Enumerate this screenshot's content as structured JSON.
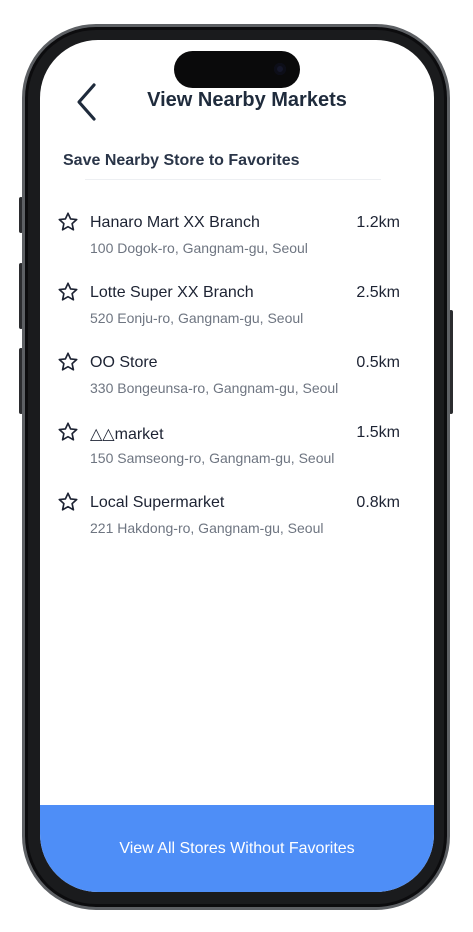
{
  "header": {
    "title": "View Nearby Markets",
    "back_icon": "chevron-left-icon"
  },
  "section": {
    "title": "Save Nearby Store to Favorites"
  },
  "stores": [
    {
      "name": "Hanaro Mart XX Branch",
      "distance": "1.2km",
      "address": "100 Dogok-ro, Gangnam-gu, Seoul",
      "icon": "star-outline-icon"
    },
    {
      "name": "Lotte Super XX Branch",
      "distance": "2.5km",
      "address": "520 Eonju-ro, Gangnam-gu, Seoul",
      "icon": "star-outline-icon"
    },
    {
      "name": "OO Store",
      "distance": "0.5km",
      "address": "330 Bongeunsa-ro, Gangnam-gu, Seoul",
      "icon": "star-outline-icon"
    },
    {
      "name": "△△market",
      "distance": "1.5km",
      "address": "150 Samseong-ro, Gangnam-gu, Seoul",
      "icon": "star-outline-icon"
    },
    {
      "name": "Local Supermarket",
      "distance": "0.8km",
      "address": "221 Hakdong-ro, Gangnam-gu, Seoul",
      "icon": "star-outline-icon"
    }
  ],
  "footer": {
    "button_label": "View All Stores Without Favorites"
  },
  "colors": {
    "accent": "#4e8ef7",
    "title_text": "#1f2b3c",
    "secondary_text": "#6e7581"
  }
}
